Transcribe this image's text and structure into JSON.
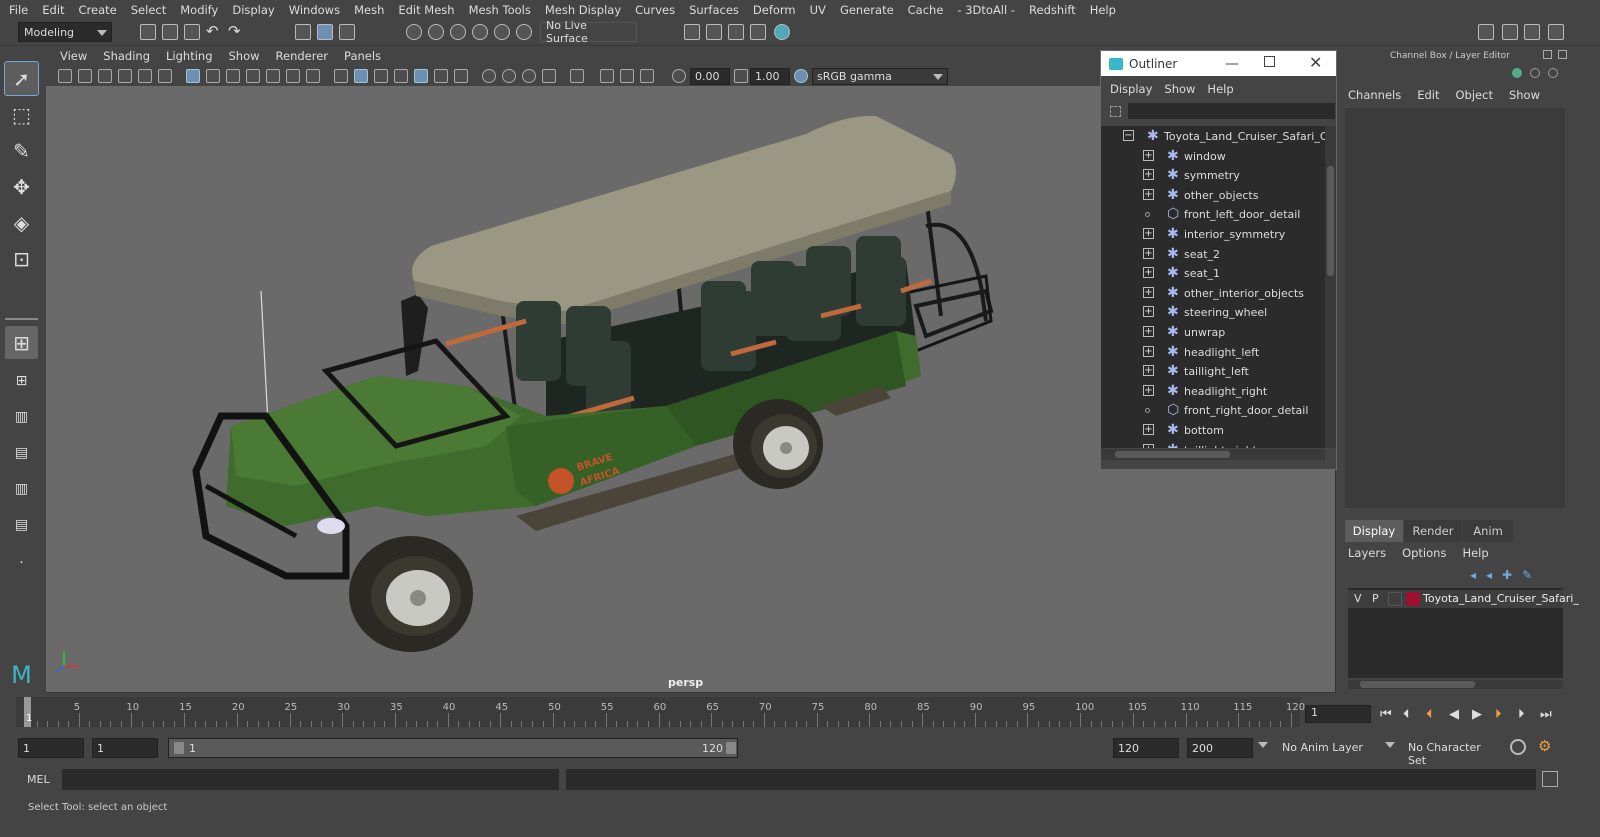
{
  "menubar": [
    "File",
    "Edit",
    "Create",
    "Select",
    "Modify",
    "Display",
    "Windows",
    "Mesh",
    "Edit Mesh",
    "Mesh Tools",
    "Mesh Display",
    "Curves",
    "Surfaces",
    "Deform",
    "UV",
    "Generate",
    "Cache",
    "- 3DtoAll -",
    "Redshift",
    "Help"
  ],
  "shelf": {
    "mode": "Modeling",
    "live_surface": "No Live Surface"
  },
  "viewport_menu": [
    "View",
    "Shading",
    "Lighting",
    "Show",
    "Renderer",
    "Panels"
  ],
  "viewport_toolbar": {
    "exposure": "0.00",
    "gamma": "1.00",
    "colorspace": "sRGB gamma"
  },
  "viewport": {
    "camera_label": "persp",
    "decal_text_1": "BRAVE",
    "decal_text_2": "AFRICA"
  },
  "outliner": {
    "title": "Outliner",
    "menu": [
      "Display",
      "Show",
      "Help"
    ],
    "items": [
      {
        "label": "Toyota_Land_Cruiser_Safari_Open",
        "type": "root"
      },
      {
        "label": "window",
        "type": "group"
      },
      {
        "label": "symmetry",
        "type": "group"
      },
      {
        "label": "other_objects",
        "type": "group"
      },
      {
        "label": "front_left_door_detail",
        "type": "mesh"
      },
      {
        "label": "interior_symmetry",
        "type": "group"
      },
      {
        "label": "seat_2",
        "type": "group"
      },
      {
        "label": "seat_1",
        "type": "group"
      },
      {
        "label": "other_interior_objects",
        "type": "group"
      },
      {
        "label": "steering_wheel",
        "type": "group"
      },
      {
        "label": "unwrap",
        "type": "group"
      },
      {
        "label": "headlight_left",
        "type": "group"
      },
      {
        "label": "taillight_left",
        "type": "group"
      },
      {
        "label": "headlight_right",
        "type": "group"
      },
      {
        "label": "front_right_door_detail",
        "type": "mesh"
      },
      {
        "label": "bottom",
        "type": "group"
      },
      {
        "label": "taillight_right",
        "type": "group"
      }
    ]
  },
  "channelbox": {
    "title": "Channel Box / Layer Editor",
    "menu": [
      "Channels",
      "Edit",
      "Object",
      "Show"
    ]
  },
  "layers": {
    "tabs": [
      "Display",
      "Render",
      "Anim"
    ],
    "menu": [
      "Layers",
      "Options",
      "Help"
    ],
    "layer": {
      "v": "V",
      "p": "P",
      "name": "Toyota_Land_Cruiser_Safari_",
      "color": "#9b1030"
    }
  },
  "timeline": {
    "ticks": [
      "5",
      "10",
      "15",
      "20",
      "25",
      "30",
      "35",
      "40",
      "45",
      "50",
      "55",
      "60",
      "65",
      "70",
      "75",
      "80",
      "85",
      "90",
      "95",
      "100",
      "105",
      "110",
      "115",
      "120"
    ],
    "current_frame": "1",
    "frame_field": "1"
  },
  "range": {
    "start": "1",
    "playback_start": "1",
    "slider_start": "1",
    "slider_end": "120",
    "playback_end": "120",
    "end": "200",
    "anim_layer": "No Anim Layer",
    "character_set": "No Character Set"
  },
  "mel": {
    "label": "MEL"
  },
  "status": {
    "text": "Select Tool: select an object"
  },
  "colors": {
    "accent": "#6fa8dc",
    "body_green": "#3f6b2c",
    "canopy": "#9a9882"
  }
}
